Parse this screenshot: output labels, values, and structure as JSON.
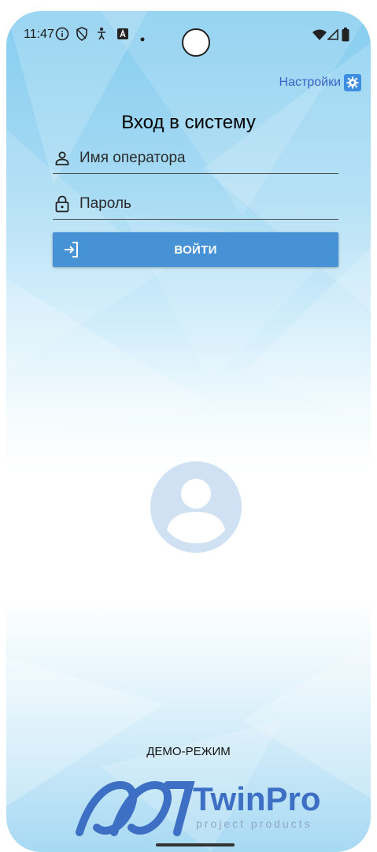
{
  "status_bar": {
    "time": "11:47",
    "left_icons": [
      "info-icon",
      "shield-icon",
      "accessibility-icon",
      "a-badge-icon",
      "dot-icon"
    ],
    "right_icons": [
      "wifi-icon",
      "signal-icon",
      "battery-icon"
    ]
  },
  "header": {
    "settings_label": "Настройки",
    "settings_icon": "gear-icon"
  },
  "login": {
    "title": "Вход в систему",
    "username_placeholder": "Имя оператора",
    "username_value": "",
    "password_placeholder": "Пароль",
    "password_value": "",
    "submit_label": "ВОЙТИ"
  },
  "footer": {
    "mode_label": "ДЕМО-РЕЖИМ",
    "logo_brand": "TwinPro",
    "logo_tagline": "project products"
  },
  "colors": {
    "accent": "#4791d5",
    "link": "#3a63c3",
    "logo_blue": "#3d6fc4",
    "avatar": "#cfe1f3"
  }
}
